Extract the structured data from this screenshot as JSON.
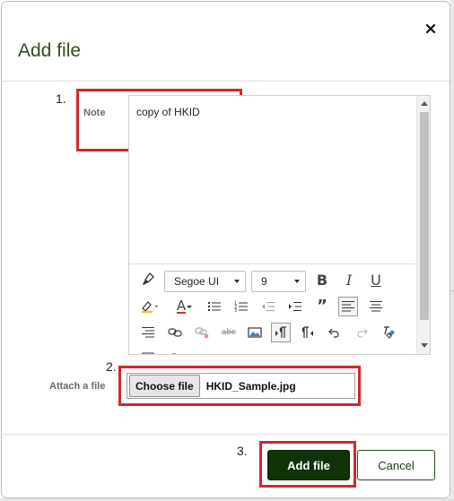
{
  "dialog": {
    "title": "Add file",
    "close_icon": "close-icon"
  },
  "annotations": {
    "step1": "1.",
    "step2": "2.",
    "step3": "3.",
    "highlight_color": "#d4262e"
  },
  "note": {
    "label": "Note",
    "value": "copy of HKID"
  },
  "toolbar": {
    "font_family": "Segoe UI",
    "font_size": "9",
    "bold": "B",
    "italic": "I",
    "underline": "U",
    "font_color": "A",
    "blockquote": "”",
    "strikethrough": "abc",
    "icons": [
      "format-painter-icon",
      "bold-icon",
      "italic-icon",
      "underline-icon",
      "highlight-color-icon",
      "font-color-icon",
      "bullet-list-icon",
      "numbered-list-icon",
      "outdent-icon",
      "indent-icon",
      "blockquote-icon",
      "align-left-icon",
      "align-center-icon",
      "align-right-icon",
      "insert-link-icon",
      "remove-link-icon",
      "strikethrough-icon",
      "insert-image-icon",
      "ltr-icon",
      "rtl-icon",
      "undo-icon",
      "redo-icon",
      "clear-formatting-icon"
    ]
  },
  "attach": {
    "label": "Attach a file",
    "button": "Choose file",
    "file_name": "HKID_Sample.jpg"
  },
  "footer": {
    "add_label": "Add file",
    "cancel_label": "Cancel"
  },
  "colors": {
    "primary": "#0f3306",
    "title": "#2e4f1f"
  }
}
